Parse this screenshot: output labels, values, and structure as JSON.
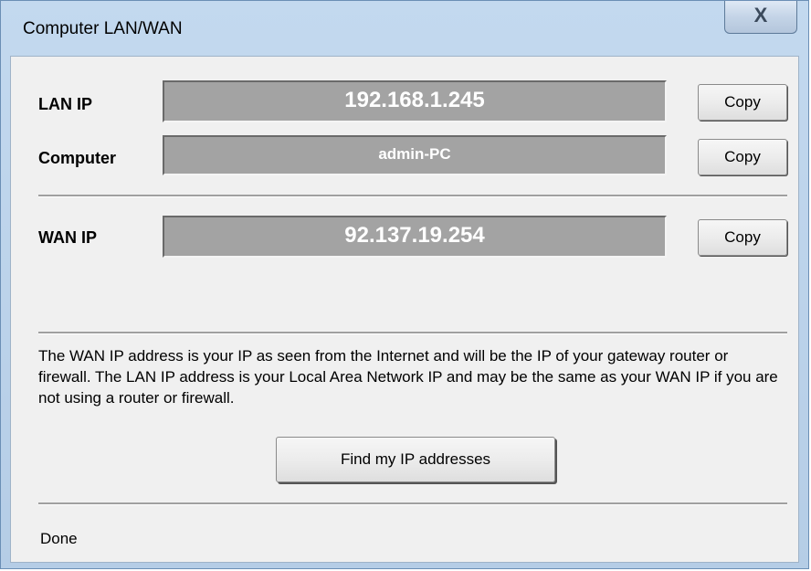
{
  "window": {
    "title": "Computer LAN/WAN",
    "close_glyph": "X",
    "close_icon": "close-icon"
  },
  "lan": {
    "label": "LAN IP",
    "value": "192.168.1.245",
    "copy_label": "Copy"
  },
  "computer": {
    "label": "Computer",
    "value": "admin-PC",
    "copy_label": "Copy"
  },
  "wan": {
    "label": "WAN IP",
    "value": "92.137.19.254",
    "copy_label": "Copy"
  },
  "info_text": "The WAN IP address is your IP as seen from the Internet and will be the IP of your gateway router or firewall. The LAN IP address is your Local Area Network IP and may be the same as your WAN IP if you are not using a router or firewall.",
  "find_button_label": "Find my IP addresses",
  "status_text": "Done",
  "colors": {
    "field_bg": "#a3a3a3",
    "field_text": "#ffffff",
    "dialog_bg": "#f0f0f0",
    "frame": "#c3d9ef"
  }
}
